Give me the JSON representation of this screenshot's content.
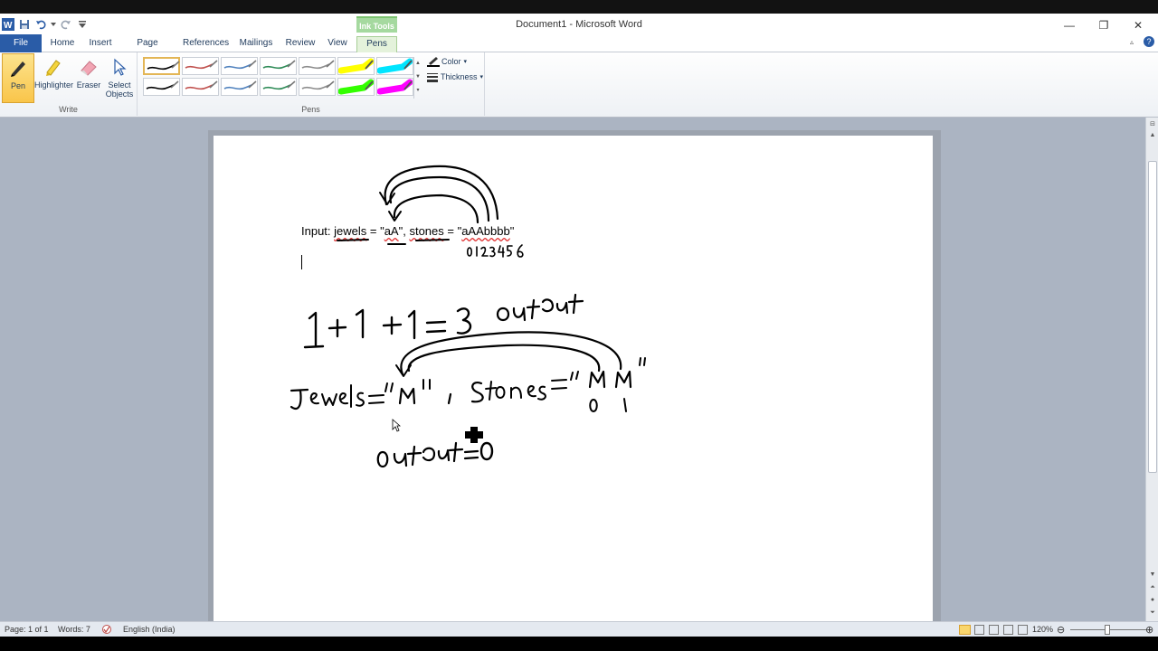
{
  "window": {
    "title": "Document1 - Microsoft Word",
    "minimize": "—",
    "maximize": "❐",
    "close": "✕"
  },
  "contextual_tab": {
    "label": "Ink Tools"
  },
  "tabs": {
    "file": "File",
    "home": "Home",
    "insert": "Insert",
    "page_layout": "Page Layout",
    "references": "References",
    "mailings": "Mailings",
    "review": "Review",
    "view": "View",
    "pens": "Pens"
  },
  "ribbon": {
    "write_group": {
      "label": "Write",
      "pen": "Pen",
      "highlighter": "Highlighter",
      "eraser": "Eraser",
      "select_objects_line1": "Select",
      "select_objects_line2": "Objects"
    },
    "pens_group": {
      "label": "Pens",
      "color": "Color",
      "thickness": "Thickness",
      "pens": [
        {
          "color": "#000000",
          "type": "pen"
        },
        {
          "color": "#c0504d",
          "type": "pen"
        },
        {
          "color": "#4f81bd",
          "type": "pen"
        },
        {
          "color": "#2e8b57",
          "type": "pen"
        },
        {
          "color": "#8c8c8c",
          "type": "pen"
        },
        {
          "color": "#ffff00",
          "type": "highlighter"
        },
        {
          "color": "#00e5ff",
          "type": "highlighter"
        },
        {
          "color": "#000000",
          "type": "pen"
        },
        {
          "color": "#c0504d",
          "type": "pen"
        },
        {
          "color": "#4f81bd",
          "type": "pen"
        },
        {
          "color": "#2e8b57",
          "type": "pen"
        },
        {
          "color": "#8c8c8c",
          "type": "pen"
        },
        {
          "color": "#33ff00",
          "type": "highlighter"
        },
        {
          "color": "#ff00ff",
          "type": "highlighter"
        }
      ]
    }
  },
  "document": {
    "line1": {
      "prefix": "Input: ",
      "jewels": "jewels",
      "eq1": " = \"",
      "jewels_value": "aA",
      "sep": "\", ",
      "stones": "stones",
      "eq2": " = \"",
      "stones_value": "aAAbbbb",
      "suffix": "\""
    }
  },
  "status": {
    "page": "Page: 1 of 1",
    "words": "Words: 7",
    "language": "English (India)",
    "zoom": "120%"
  },
  "colors": {
    "file_tab": "#2a5ca7",
    "ink_tools": "#a5d99f",
    "workspace": "#abb4c2"
  }
}
